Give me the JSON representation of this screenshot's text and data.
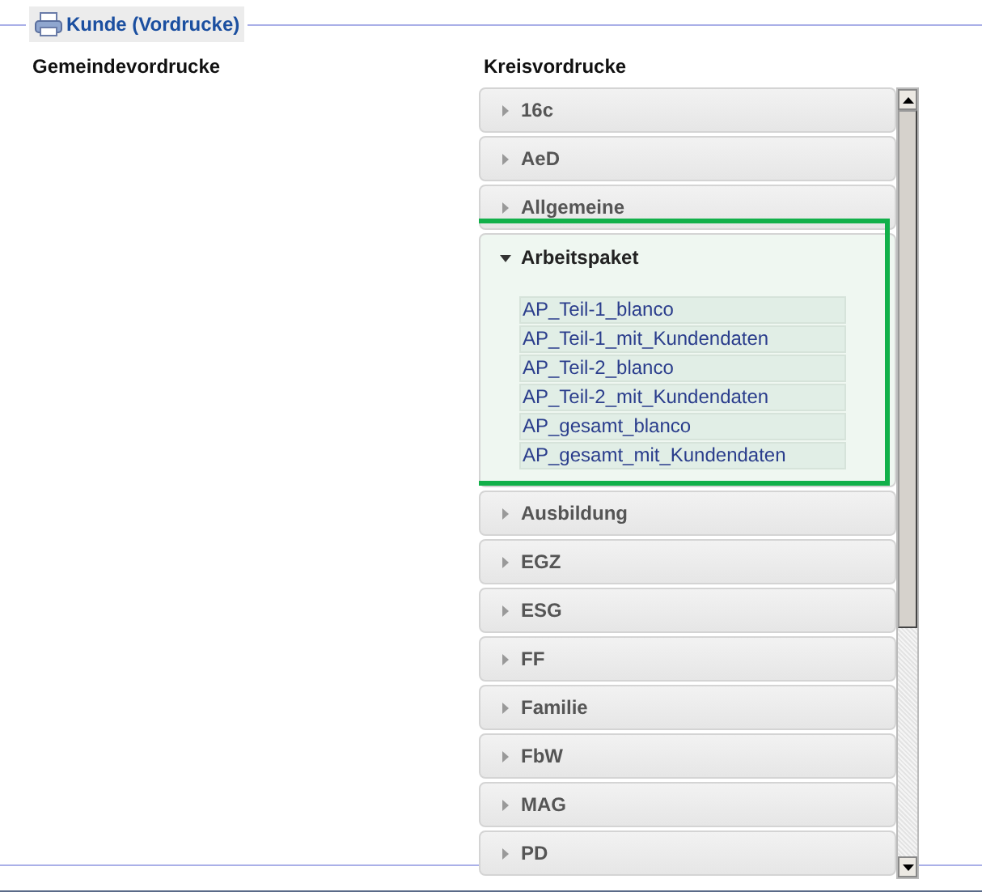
{
  "fieldset": {
    "legend": "Kunde (Vordrucke)"
  },
  "columns": [
    {
      "heading": "Gemeindevordrucke"
    },
    {
      "heading": "Kreisvordrucke"
    }
  ],
  "accordion": [
    {
      "label": "16c",
      "expanded": false
    },
    {
      "label": "AeD",
      "expanded": false
    },
    {
      "label": "Allgemeine",
      "expanded": false
    },
    {
      "label": "Arbeitspaket",
      "expanded": true,
      "highlighted": true,
      "documents": [
        "AP_Teil-1_blanco",
        "AP_Teil-1_mit_Kundendaten",
        "AP_Teil-2_blanco",
        "AP_Teil-2_mit_Kundendaten",
        "AP_gesamt_blanco",
        "AP_gesamt_mit_Kundendaten"
      ]
    },
    {
      "label": "Ausbildung",
      "expanded": false
    },
    {
      "label": "EGZ",
      "expanded": false
    },
    {
      "label": "ESG",
      "expanded": false
    },
    {
      "label": "FF",
      "expanded": false
    },
    {
      "label": "Familie",
      "expanded": false
    },
    {
      "label": "FbW",
      "expanded": false
    },
    {
      "label": "MAG",
      "expanded": false
    },
    {
      "label": "PD",
      "expanded": false
    }
  ]
}
